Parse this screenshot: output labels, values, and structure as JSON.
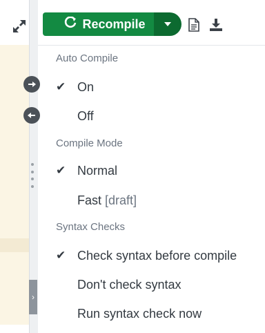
{
  "toolbar": {
    "recompile_label": "Recompile",
    "icons": {
      "expand": "expand-arrows-icon",
      "refresh": "refresh-icon",
      "caret": "caret-down-icon",
      "logs": "document-icon",
      "download": "download-icon"
    }
  },
  "menu": {
    "sections": [
      {
        "header": "Auto Compile",
        "items": [
          {
            "label": "On",
            "checked": true
          },
          {
            "label": "Off",
            "checked": false
          }
        ]
      },
      {
        "header": "Compile Mode",
        "items": [
          {
            "label": "Normal",
            "checked": true
          },
          {
            "label": "Fast",
            "suffix": "[draft]",
            "checked": false
          }
        ]
      },
      {
        "header": "Syntax Checks",
        "items": [
          {
            "label": "Check syntax before compile",
            "checked": true
          },
          {
            "label": "Don't check syntax",
            "checked": false
          },
          {
            "label": "Run syntax check now",
            "checked": false
          }
        ]
      }
    ]
  },
  "colors": {
    "brand_green": "#138a42",
    "brand_green_dark": "#0c6a30",
    "text": "#333a41",
    "muted": "#6b7480"
  }
}
